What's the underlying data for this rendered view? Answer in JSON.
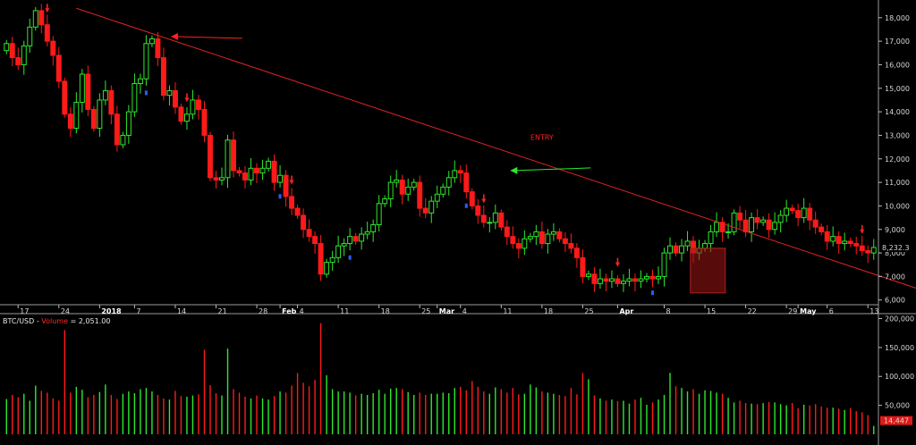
{
  "chart_data": [
    {
      "type": "candlestick",
      "ylim": [
        5800,
        18600
      ],
      "y_ticks": [
        6000,
        7000,
        8000,
        9000,
        10000,
        11000,
        12000,
        13000,
        14000,
        15000,
        16000,
        17000,
        18000
      ],
      "y_tick_labels": [
        "6,000",
        "7,000",
        "8,000",
        "9,000",
        "10,000",
        "11,000",
        "12,000",
        "13,000",
        "14,000",
        "15,000",
        "16,000",
        "17,000",
        "18,000"
      ],
      "x_tick_labels": [
        {
          "label": "17",
          "bar": 2,
          "bold": false
        },
        {
          "label": "24",
          "bar": 9,
          "bold": false
        },
        {
          "label": "2018",
          "bar": 16,
          "bold": true
        },
        {
          "label": "7",
          "bar": 22,
          "bold": false
        },
        {
          "label": "14",
          "bar": 29,
          "bold": false
        },
        {
          "label": "21",
          "bar": 36,
          "bold": false
        },
        {
          "label": "28",
          "bar": 43,
          "bold": false
        },
        {
          "label": "Feb",
          "bar": 47,
          "bold": true
        },
        {
          "label": "4",
          "bar": 50,
          "bold": false
        },
        {
          "label": "11",
          "bar": 57,
          "bold": false
        },
        {
          "label": "18",
          "bar": 64,
          "bold": false
        },
        {
          "label": "25",
          "bar": 71,
          "bold": false
        },
        {
          "label": "Mar",
          "bar": 74,
          "bold": true
        },
        {
          "label": "4",
          "bar": 78,
          "bold": false
        },
        {
          "label": "11",
          "bar": 85,
          "bold": false
        },
        {
          "label": "18",
          "bar": 92,
          "bold": false
        },
        {
          "label": "25",
          "bar": 99,
          "bold": false
        },
        {
          "label": "Apr",
          "bar": 105,
          "bold": true
        },
        {
          "label": "8",
          "bar": 113,
          "bold": false
        },
        {
          "label": "15",
          "bar": 120,
          "bold": false
        },
        {
          "label": "22",
          "bar": 127,
          "bold": false
        },
        {
          "label": "29",
          "bar": 134,
          "bold": false
        },
        {
          "label": "May",
          "bar": 136,
          "bold": true
        },
        {
          "label": "6",
          "bar": 141,
          "bold": false
        },
        {
          "label": "13",
          "bar": 148,
          "bold": false
        }
      ],
      "closes": [
        16900,
        16300,
        16000,
        16800,
        17600,
        18300,
        17700,
        17000,
        16400,
        15300,
        13900,
        13300,
        14400,
        15600,
        14100,
        13300,
        14500,
        14900,
        13900,
        12600,
        13000,
        14000,
        15200,
        15400,
        16900,
        17100,
        16300,
        14700,
        14900,
        14200,
        13600,
        13900,
        14500,
        14100,
        13000,
        11200,
        11100,
        11200,
        12800,
        11500,
        11400,
        11100,
        11600,
        11400,
        11600,
        11900,
        11000,
        11300,
        10400,
        9900,
        9600,
        9000,
        8700,
        8400,
        7100,
        7600,
        7800,
        8300,
        8400,
        8700,
        8500,
        8800,
        8900,
        9200,
        10100,
        10300,
        11000,
        11100,
        10500,
        10800,
        11000,
        9900,
        9700,
        10200,
        10500,
        10800,
        11200,
        11500,
        11400,
        10600,
        10000,
        9600,
        9300,
        9300,
        9700,
        9100,
        8700,
        8400,
        8200,
        8600,
        8700,
        8900,
        8400,
        8800,
        8900,
        8600,
        8400,
        8200,
        7800,
        7000,
        7100,
        6700,
        6900,
        6800,
        6900,
        6700,
        6800,
        6900,
        6800,
        6900,
        7000,
        6900,
        7000,
        8000,
        8300,
        8000,
        8300,
        8500,
        8000,
        8200,
        8400,
        8900,
        9300,
        8900,
        8900,
        9700,
        9400,
        8900,
        9500,
        9300,
        9400,
        9000,
        9300,
        9600,
        9900,
        9800,
        9500,
        9900,
        9400,
        9100,
        8900,
        8500,
        8700,
        8400,
        8500,
        8400,
        8300,
        8100,
        8000,
        8232.3
      ],
      "last_price_label": "8,232.3",
      "indicators": {
        "trendline": {
          "from": [
            12,
            18400
          ],
          "to": [
            163,
            5950
          ]
        },
        "entry_box": {
          "bars": [
            118,
            123
          ],
          "low": 6300,
          "high": 8200
        },
        "annotations": [
          {
            "text": "ENTRY",
            "bar": 92,
            "value": 12800,
            "color": "#ff2020"
          }
        ],
        "red_down_markers": [
          7,
          31,
          49,
          82,
          105,
          147
        ],
        "blue_markers": [
          24,
          47,
          59,
          79,
          111
        ],
        "green_arrow": {
          "bar": 85,
          "value": 11500
        },
        "red_arrow": {
          "bar": 27,
          "value": 17200
        }
      }
    },
    {
      "type": "bar",
      "title": "BTC/USD - Volume = 2,051.00",
      "title_parts": {
        "symbol": "BTC/USD",
        "sep": " - ",
        "metric": "Volume",
        "value": " = 2,051.00"
      },
      "ylim": [
        0,
        210000
      ],
      "y_ticks": [
        50000,
        100000,
        150000,
        200000
      ],
      "y_tick_labels": [
        "50,000",
        "100,000",
        "150,000",
        "200,000"
      ],
      "last_value_label": "14,447",
      "values": [
        61000,
        68000,
        64000,
        70000,
        58000,
        84000,
        75000,
        72000,
        62000,
        58000,
        180000,
        72000,
        82000,
        77000,
        64000,
        68000,
        73000,
        86000,
        68000,
        61000,
        70000,
        74000,
        71000,
        78000,
        80000,
        74000,
        68000,
        62000,
        60000,
        75000,
        66000,
        65000,
        67000,
        69000,
        146000,
        85000,
        71000,
        67000,
        148000,
        78000,
        72000,
        65000,
        62000,
        67000,
        62000,
        60000,
        66000,
        74000,
        72000,
        84000,
        106000,
        89000,
        83000,
        94000,
        192000,
        102000,
        78000,
        74000,
        74000,
        72000,
        67000,
        70000,
        68000,
        71000,
        77000,
        70000,
        79000,
        80000,
        78000,
        73000,
        68000,
        72000,
        68000,
        70000,
        70000,
        72000,
        71000,
        80000,
        82000,
        76000,
        92000,
        82000,
        74000,
        70000,
        81000,
        78000,
        72000,
        80000,
        69000,
        70000,
        86000,
        81000,
        74000,
        72000,
        70000,
        68000,
        66000,
        80000,
        69000,
        106000,
        95000,
        67000,
        62000,
        58000,
        60000,
        57000,
        58000,
        53000,
        60000,
        63000,
        51000,
        55000,
        60000,
        68000,
        106000,
        83000,
        80000,
        74000,
        78000,
        70000,
        76000,
        75000,
        72000,
        70000,
        63000,
        55000,
        58000,
        54000,
        53000,
        52000,
        54000,
        56000,
        55000,
        52000,
        50000,
        54000,
        45000,
        51000,
        50000,
        52000,
        48000,
        46000,
        46000,
        44000,
        42000,
        45000,
        40000,
        38000,
        33000,
        14447
      ]
    }
  ]
}
